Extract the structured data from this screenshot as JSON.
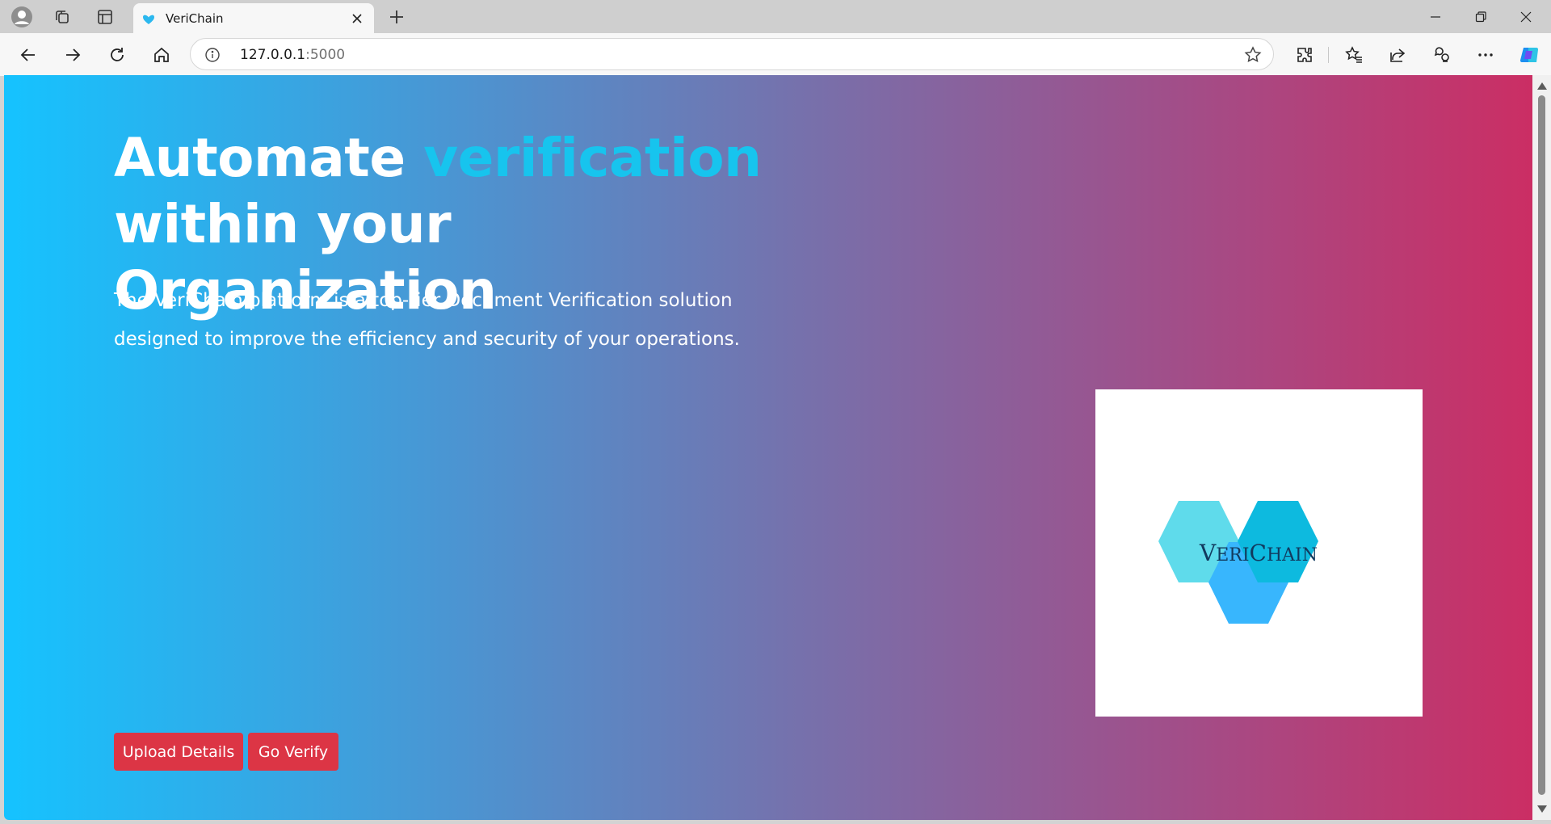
{
  "browser": {
    "tab": {
      "title": "VeriChain",
      "favicon": "verichain-heart-icon"
    },
    "address_host": "127.0.0.1",
    "address_port": ":5000",
    "icons": {
      "profile": "profile-icon",
      "workspaces": "workspaces-icon",
      "tab_actions": "tab-actions-icon",
      "close_tab": "close-icon",
      "new_tab": "plus-icon",
      "minimize": "minimize-icon",
      "restore": "restore-icon",
      "close_window": "close-icon",
      "back": "back-arrow-icon",
      "forward": "forward-arrow-icon",
      "refresh": "refresh-icon",
      "home": "home-icon",
      "site_info": "info-icon",
      "favorite_star": "star-icon",
      "extensions": "extensions-icon",
      "favorites": "favorites-icon",
      "share": "share-icon",
      "profile_sync": "browser-essentials-icon",
      "more": "more-icon",
      "copilot": "copilot-icon"
    }
  },
  "hero": {
    "title_part1": "Automate",
    "title_accent": "verification",
    "title_part2": "within your Organization",
    "desc_line1": "The VeriChain platform is a top-tier Document Verification solution",
    "desc_line2": "designed to improve the efficiency and security of your operations."
  },
  "logo": {
    "text_big1": "V",
    "text_small1": "ERI",
    "text_big2": "C",
    "text_small2": "HAIN"
  },
  "buttons": {
    "upload": "Upload Details",
    "verify": "Go Verify"
  },
  "colors": {
    "accent": "#17c4ee",
    "button": "#dc3545",
    "gradient_start": "#15c3ff",
    "gradient_end": "#cb2e64",
    "hex_light": "#5fdbeb",
    "hex_teal": "#0dbadf",
    "hex_blue": "#38b6fd"
  }
}
